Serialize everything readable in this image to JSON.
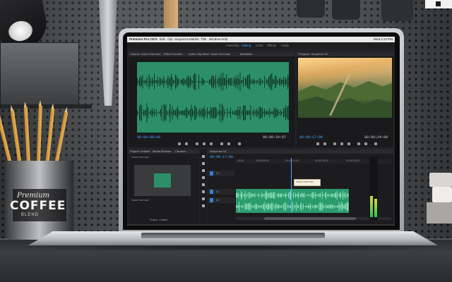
{
  "scene": {
    "cup_label": {
      "brand": "Premium",
      "word": "COFFEE",
      "small": "BLEND"
    }
  },
  "premiere": {
    "menubar": {
      "items": [
        "Premiere Pro CC",
        "File",
        "Edit",
        "Clip",
        "Sequence",
        "Marker",
        "Title",
        "Window",
        "Help"
      ],
      "clock": "Wed 4:13 PM"
    },
    "workspace_tabs": [
      {
        "label": "Assembly",
        "active": false
      },
      {
        "label": "Editing",
        "active": true
      },
      {
        "label": "Color",
        "active": false
      },
      {
        "label": "Effects",
        "active": false
      },
      {
        "label": "Audio",
        "active": false
      }
    ],
    "source_panel": {
      "tabs": [
        "Source: Voice Over.wav",
        "Effect Controls",
        "Audio Clip Mixer: Voice Over.wav",
        "Metadata"
      ],
      "timecode_in": "00:00:00:00",
      "timecode_out": "00:00:24:07"
    },
    "program_panel": {
      "title": "Program: Sequence 01",
      "timecode_in": "00:00:17:00",
      "timecode_out": "00:00:24:00"
    },
    "project_panel": {
      "tabs": [
        "Project: Untitled",
        "Media Browser",
        "Libraries"
      ],
      "thumb_label": "Voice Over.wav",
      "footer": "Project: Untitled",
      "footer_sub": "Voice Over"
    },
    "timeline": {
      "title": "Sequence 01",
      "timecode": "00:00:17:00",
      "ruler": [
        "00:00",
        "00:00:05:00",
        "00:00:10:00",
        "00:00:15:00",
        "00:00:20:00"
      ],
      "tooltip": "Voice Over.wav",
      "tracks": [
        "V1",
        "A1",
        "A2"
      ]
    },
    "colors": {
      "accent": "#4da5ff",
      "audio_clip": "#2b9b6e",
      "waveform_bg": "#2c8f68"
    }
  }
}
